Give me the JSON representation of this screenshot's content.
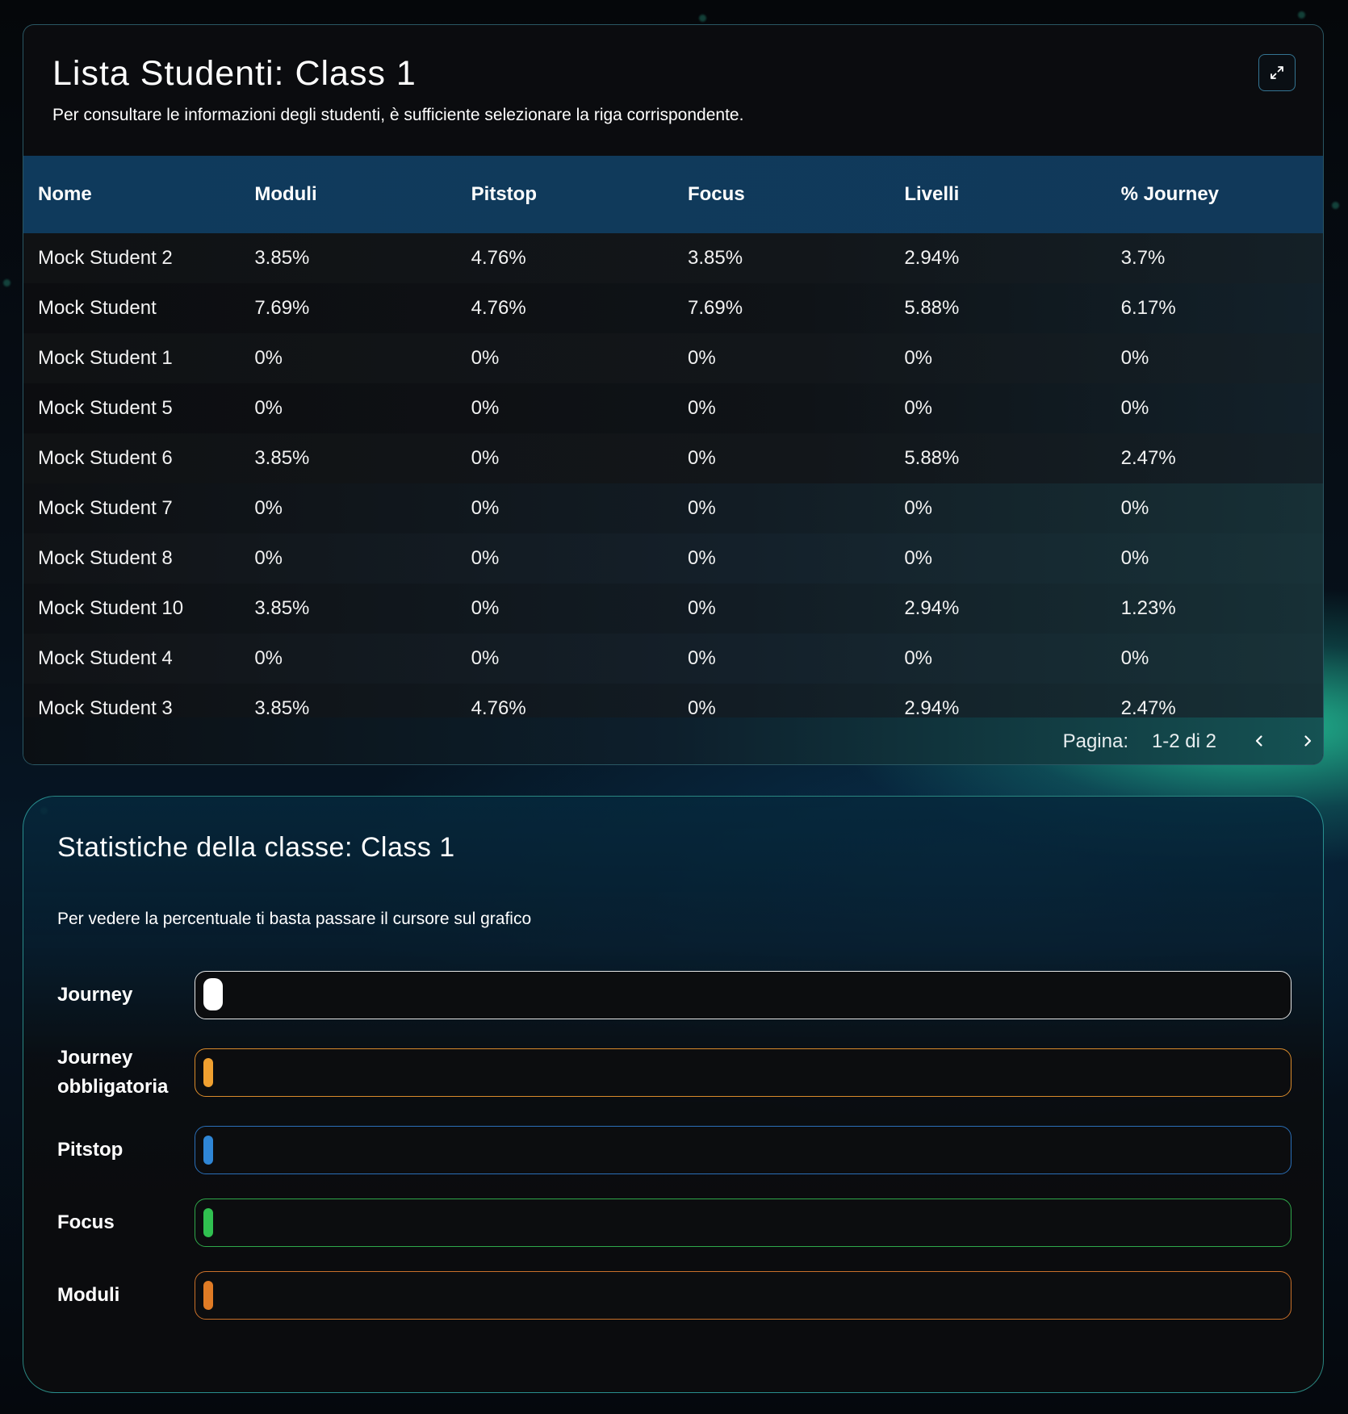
{
  "student_list": {
    "title": "Lista Studenti: Class 1",
    "subtitle": "Per consultare le informazioni degli studenti, è sufficiente selezionare la riga corrispondente.",
    "columns": [
      "Nome",
      "Moduli",
      "Pitstop",
      "Focus",
      "Livelli",
      "% Journey"
    ],
    "rows": [
      [
        "Mock Student 2",
        "3.85%",
        "4.76%",
        "3.85%",
        "2.94%",
        "3.7%"
      ],
      [
        "Mock Student",
        "7.69%",
        "4.76%",
        "7.69%",
        "5.88%",
        "6.17%"
      ],
      [
        "Mock Student 1",
        "0%",
        "0%",
        "0%",
        "0%",
        "0%"
      ],
      [
        "Mock Student 5",
        "0%",
        "0%",
        "0%",
        "0%",
        "0%"
      ],
      [
        "Mock Student 6",
        "3.85%",
        "0%",
        "0%",
        "5.88%",
        "2.47%"
      ],
      [
        "Mock Student 7",
        "0%",
        "0%",
        "0%",
        "0%",
        "0%"
      ],
      [
        "Mock Student 8",
        "0%",
        "0%",
        "0%",
        "0%",
        "0%"
      ],
      [
        "Mock Student 10",
        "3.85%",
        "0%",
        "0%",
        "2.94%",
        "1.23%"
      ],
      [
        "Mock Student 4",
        "0%",
        "0%",
        "0%",
        "0%",
        "0%"
      ],
      [
        "Mock Student 3",
        "3.85%",
        "4.76%",
        "0%",
        "2.94%",
        "2.47%"
      ]
    ],
    "pagination": {
      "label": "Pagina:",
      "range": "1-2 di 2"
    },
    "icons": {
      "expand": "expand-icon",
      "prev": "chevron-left-icon",
      "next": "chevron-right-icon"
    }
  },
  "class_stats": {
    "title": "Statistiche della classe: Class 1",
    "subtitle": "Per vedere la percentuale ti basta passare il cursore sul grafico",
    "bars": [
      {
        "label": "Journey",
        "border_color": "#e6e6e6",
        "fill_color": "#ffffff",
        "fill_fraction": 0.018
      },
      {
        "label": "Journey obbligatoria",
        "border_color": "#d98a2b",
        "fill_color": "#f0a030",
        "fill_fraction": 0.008
      },
      {
        "label": "Pitstop",
        "border_color": "#2a6fb8",
        "fill_color": "#2f86d6",
        "fill_fraction": 0.008
      },
      {
        "label": "Focus",
        "border_color": "#2fa84a",
        "fill_color": "#30c050",
        "fill_fraction": 0.008
      },
      {
        "label": "Moduli",
        "border_color": "#c9702a",
        "fill_color": "#e07b25",
        "fill_fraction": 0.008
      }
    ]
  }
}
